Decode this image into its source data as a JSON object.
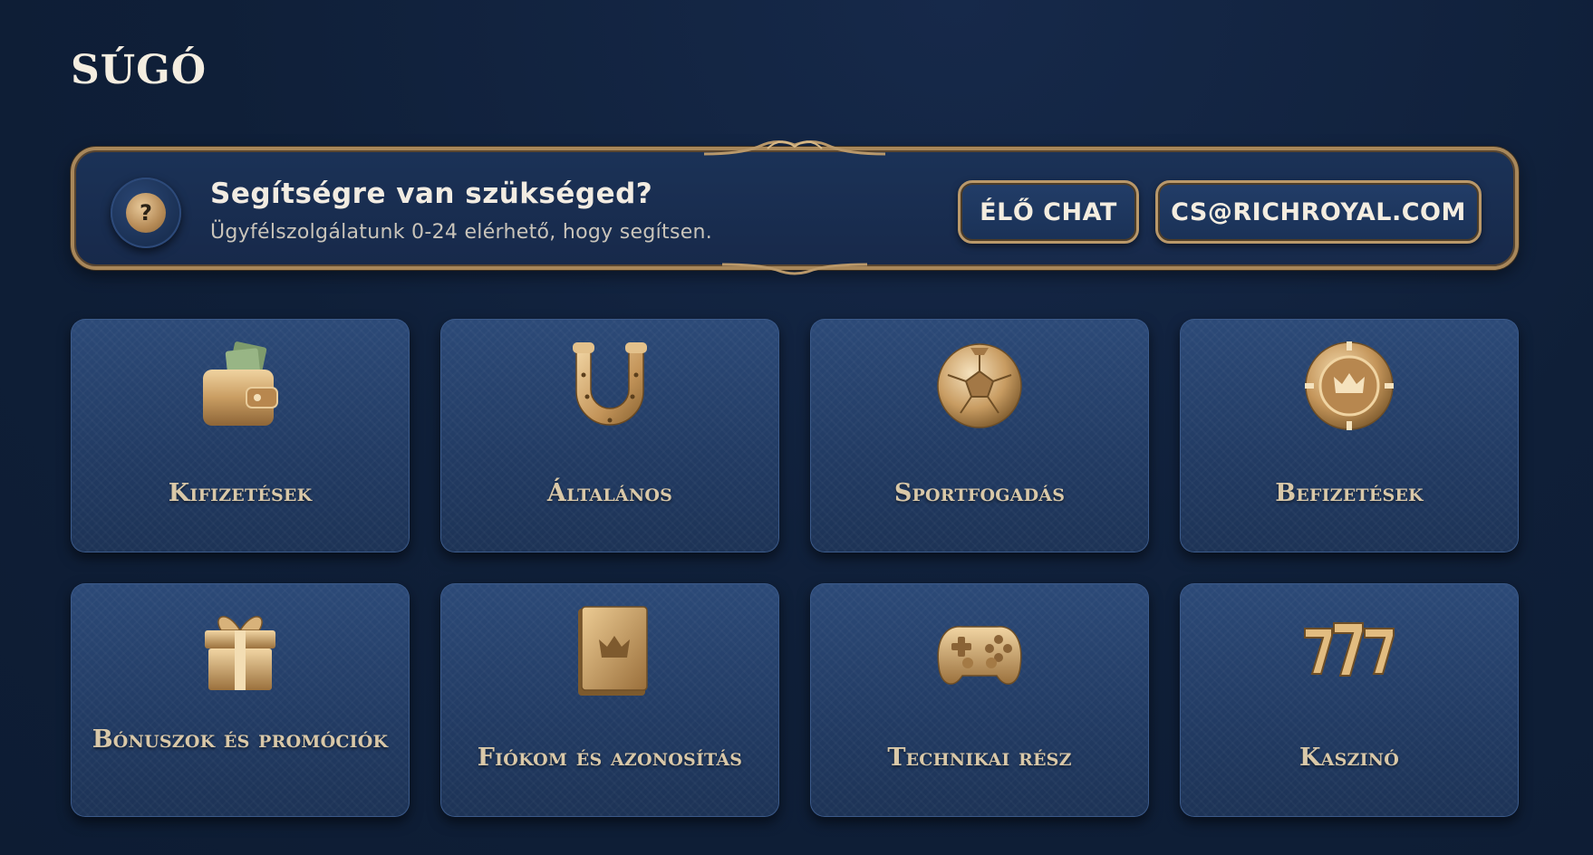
{
  "page": {
    "title": "SÚGÓ"
  },
  "help_banner": {
    "title": "Segítségre van szükséged?",
    "subtitle": "Ügyfélszolgálatunk 0-24 elérhető, hogy segítsen.",
    "icon": "question-icon",
    "icon_glyph": "?",
    "chat_button": "ÉLŐ CHAT",
    "email_button": "CS@RICHROYAL.COM"
  },
  "categories": [
    {
      "label": "Kifizetések",
      "icon": "wallet-icon"
    },
    {
      "label": "Általános",
      "icon": "horseshoe-icon"
    },
    {
      "label": "Sportfogadás",
      "icon": "soccer-ball-icon"
    },
    {
      "label": "Befizetések",
      "icon": "chip-icon"
    },
    {
      "label": "Bónuszok és promóciók",
      "icon": "gift-icon"
    },
    {
      "label": "Fiókom és azonosítás",
      "icon": "book-icon"
    },
    {
      "label": "Technikai rész",
      "icon": "gamepad-icon"
    },
    {
      "label": "Kaszinó",
      "icon": "slot-777-icon"
    }
  ],
  "colors": {
    "background": "#0f1f38",
    "card": "#26426d",
    "gold": "#b9986a",
    "label": "#d9c8a8"
  }
}
